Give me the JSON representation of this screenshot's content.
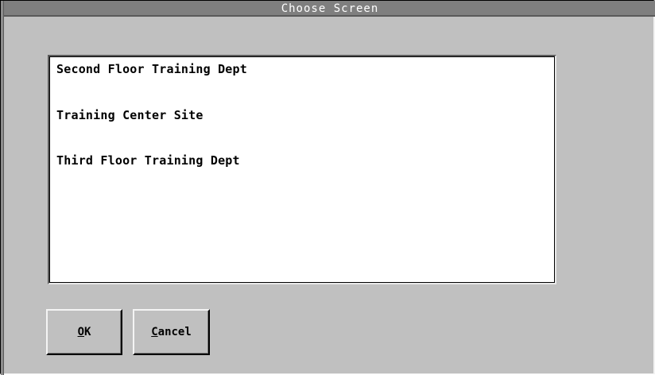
{
  "window": {
    "title": "Choose Screen"
  },
  "list": {
    "items": [
      {
        "label": "Second Floor Training Dept"
      },
      {
        "label": "Training Center Site"
      },
      {
        "label": "Third Floor Training Dept"
      }
    ]
  },
  "buttons": {
    "ok": {
      "mnemonic": "O",
      "rest": "K"
    },
    "cancel": {
      "mnemonic": "C",
      "rest": "ancel"
    }
  },
  "colors": {
    "window_bg": "#c0c0c0",
    "title_bar_bg": "#7f7f7f",
    "title_text": "#ffffff",
    "list_bg": "#ffffff"
  }
}
